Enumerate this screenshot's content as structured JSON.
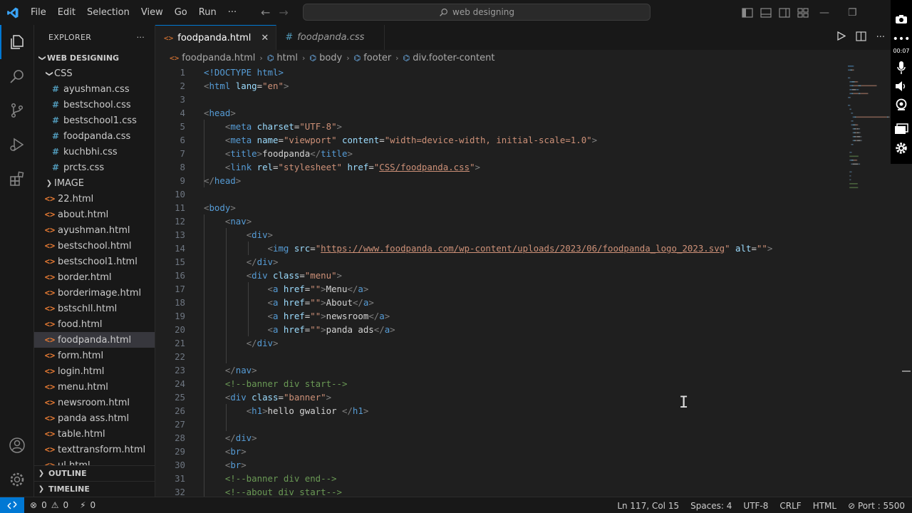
{
  "titlebar": {
    "menu": [
      "File",
      "Edit",
      "Selection",
      "View",
      "Go",
      "Run",
      "···"
    ],
    "search_text": "web designing"
  },
  "explorer": {
    "title": "EXPLORER",
    "more": "···",
    "root": "WEB DESIGNING",
    "css_folder": "CSS",
    "css_files": [
      "ayushman.css",
      "bestschool.css",
      "bestschool1.css",
      "foodpanda.css",
      "kuchbhi.css",
      "prcts.css"
    ],
    "image_folder": "IMAGE",
    "html_files": [
      "22.html",
      "about.html",
      "ayushman.html",
      "bestschool.html",
      "bestschool1.html",
      "border.html",
      "borderimage.html",
      "bstschll.html",
      "food.html",
      "foodpanda.html",
      "form.html",
      "login.html",
      "menu.html",
      "newsroom.html",
      "panda ass.html",
      "table.html",
      "texttransform.html",
      "ul.html"
    ],
    "selected_file": "foodpanda.html",
    "outline": "OUTLINE",
    "timeline": "TIMELINE"
  },
  "tabs": [
    {
      "label": "foodpanda.html",
      "icon": "<>",
      "active": true
    },
    {
      "label": "foodpanda.css",
      "icon": "#",
      "active": false
    }
  ],
  "breadcrumb": [
    "foodpanda.html",
    "html",
    "body",
    "footer",
    "div.footer-content"
  ],
  "code_lines": [
    [
      [
        "doc",
        "<!DOCTYPE "
      ],
      [
        "t-tag",
        "html"
      ],
      [
        "doc",
        ">"
      ]
    ],
    [
      [
        "br",
        "<"
      ],
      [
        "tag",
        "html "
      ],
      [
        "attr",
        "lang"
      ],
      [
        "txt",
        "="
      ],
      [
        "str",
        "\"en\""
      ],
      [
        "br",
        ">"
      ]
    ],
    [],
    [
      [
        "br",
        "<"
      ],
      [
        "tag",
        "head"
      ],
      [
        "br",
        ">"
      ]
    ],
    [
      [
        "sp",
        "    "
      ],
      [
        "br",
        "<"
      ],
      [
        "tag",
        "meta "
      ],
      [
        "attr",
        "charset"
      ],
      [
        "txt",
        "="
      ],
      [
        "str",
        "\"UTF-8\""
      ],
      [
        "br",
        ">"
      ]
    ],
    [
      [
        "sp",
        "    "
      ],
      [
        "br",
        "<"
      ],
      [
        "tag",
        "meta "
      ],
      [
        "attr",
        "name"
      ],
      [
        "txt",
        "="
      ],
      [
        "str",
        "\"viewport\" "
      ],
      [
        "attr",
        "content"
      ],
      [
        "txt",
        "="
      ],
      [
        "str",
        "\"width=device-width, initial-scale=1.0\""
      ],
      [
        "br",
        ">"
      ]
    ],
    [
      [
        "sp",
        "    "
      ],
      [
        "br",
        "<"
      ],
      [
        "tag",
        "title"
      ],
      [
        "br",
        ">"
      ],
      [
        "txt",
        "foodpanda"
      ],
      [
        "br",
        "</"
      ],
      [
        "tag",
        "title"
      ],
      [
        "br",
        ">"
      ]
    ],
    [
      [
        "sp",
        "    "
      ],
      [
        "br",
        "<"
      ],
      [
        "tag",
        "link "
      ],
      [
        "attr",
        "rel"
      ],
      [
        "txt",
        "="
      ],
      [
        "str",
        "\"stylesheet\" "
      ],
      [
        "attr",
        "href"
      ],
      [
        "txt",
        "="
      ],
      [
        "str",
        "\""
      ],
      [
        "link",
        "CSS/foodpanda.css"
      ],
      [
        "str",
        "\""
      ],
      [
        "br",
        ">"
      ]
    ],
    [
      [
        "br",
        "</"
      ],
      [
        "tag",
        "head"
      ],
      [
        "br",
        ">"
      ]
    ],
    [],
    [
      [
        "br",
        "<"
      ],
      [
        "tag",
        "body"
      ],
      [
        "br",
        ">"
      ]
    ],
    [
      [
        "sp",
        "    "
      ],
      [
        "br",
        "<"
      ],
      [
        "tag",
        "nav"
      ],
      [
        "br",
        ">"
      ]
    ],
    [
      [
        "sp",
        "        "
      ],
      [
        "br",
        "<"
      ],
      [
        "tag",
        "div"
      ],
      [
        "br",
        ">"
      ]
    ],
    [
      [
        "sp",
        "            "
      ],
      [
        "br",
        "<"
      ],
      [
        "tag",
        "img "
      ],
      [
        "attr",
        "src"
      ],
      [
        "txt",
        "="
      ],
      [
        "str",
        "\""
      ],
      [
        "link",
        "https://www.foodpanda.com/wp-content/uploads/2023/06/foodpanda_logo_2023.svg"
      ],
      [
        "str",
        "\" "
      ],
      [
        "attr",
        "alt"
      ],
      [
        "txt",
        "="
      ],
      [
        "str",
        "\"\""
      ],
      [
        "br",
        ">"
      ]
    ],
    [
      [
        "sp",
        "        "
      ],
      [
        "br",
        "</"
      ],
      [
        "tag",
        "div"
      ],
      [
        "br",
        ">"
      ]
    ],
    [
      [
        "sp",
        "        "
      ],
      [
        "br",
        "<"
      ],
      [
        "tag",
        "div "
      ],
      [
        "attr",
        "class"
      ],
      [
        "txt",
        "="
      ],
      [
        "str",
        "\"menu\""
      ],
      [
        "br",
        ">"
      ]
    ],
    [
      [
        "sp",
        "            "
      ],
      [
        "br",
        "<"
      ],
      [
        "tag",
        "a "
      ],
      [
        "attr",
        "href"
      ],
      [
        "txt",
        "="
      ],
      [
        "str",
        "\"\""
      ],
      [
        "br",
        ">"
      ],
      [
        "txt",
        "Menu"
      ],
      [
        "br",
        "</"
      ],
      [
        "tag",
        "a"
      ],
      [
        "br",
        ">"
      ]
    ],
    [
      [
        "sp",
        "            "
      ],
      [
        "br",
        "<"
      ],
      [
        "tag",
        "a "
      ],
      [
        "attr",
        "href"
      ],
      [
        "txt",
        "="
      ],
      [
        "str",
        "\"\""
      ],
      [
        "br",
        ">"
      ],
      [
        "txt",
        "About"
      ],
      [
        "br",
        "</"
      ],
      [
        "tag",
        "a"
      ],
      [
        "br",
        ">"
      ]
    ],
    [
      [
        "sp",
        "            "
      ],
      [
        "br",
        "<"
      ],
      [
        "tag",
        "a "
      ],
      [
        "attr",
        "href"
      ],
      [
        "txt",
        "="
      ],
      [
        "str",
        "\"\""
      ],
      [
        "br",
        ">"
      ],
      [
        "txt",
        "newsroom"
      ],
      [
        "br",
        "</"
      ],
      [
        "tag",
        "a"
      ],
      [
        "br",
        ">"
      ]
    ],
    [
      [
        "sp",
        "            "
      ],
      [
        "br",
        "<"
      ],
      [
        "tag",
        "a "
      ],
      [
        "attr",
        "href"
      ],
      [
        "txt",
        "="
      ],
      [
        "str",
        "\"\""
      ],
      [
        "br",
        ">"
      ],
      [
        "txt",
        "panda ads"
      ],
      [
        "br",
        "</"
      ],
      [
        "tag",
        "a"
      ],
      [
        "br",
        ">"
      ]
    ],
    [
      [
        "sp",
        "        "
      ],
      [
        "br",
        "</"
      ],
      [
        "tag",
        "div"
      ],
      [
        "br",
        ">"
      ]
    ],
    [],
    [
      [
        "sp",
        "    "
      ],
      [
        "br",
        "</"
      ],
      [
        "tag",
        "nav"
      ],
      [
        "br",
        ">"
      ]
    ],
    [
      [
        "sp",
        "    "
      ],
      [
        "cmt",
        "<!--banner div start-->"
      ]
    ],
    [
      [
        "sp",
        "    "
      ],
      [
        "br",
        "<"
      ],
      [
        "tag",
        "div "
      ],
      [
        "attr",
        "class"
      ],
      [
        "txt",
        "="
      ],
      [
        "str",
        "\"banner\""
      ],
      [
        "br",
        ">"
      ]
    ],
    [
      [
        "sp",
        "        "
      ],
      [
        "br",
        "<"
      ],
      [
        "tag",
        "h1"
      ],
      [
        "br",
        ">"
      ],
      [
        "txt",
        "hello gwalior "
      ],
      [
        "br",
        "</"
      ],
      [
        "tag",
        "h1"
      ],
      [
        "br",
        ">"
      ]
    ],
    [],
    [
      [
        "sp",
        "    "
      ],
      [
        "br",
        "</"
      ],
      [
        "tag",
        "div"
      ],
      [
        "br",
        ">"
      ]
    ],
    [
      [
        "sp",
        "    "
      ],
      [
        "br",
        "<"
      ],
      [
        "tag",
        "br"
      ],
      [
        "br",
        ">"
      ]
    ],
    [
      [
        "sp",
        "    "
      ],
      [
        "br",
        "<"
      ],
      [
        "tag",
        "br"
      ],
      [
        "br",
        ">"
      ]
    ],
    [
      [
        "sp",
        "    "
      ],
      [
        "cmt",
        "<!--banner div end-->"
      ]
    ],
    [
      [
        "sp",
        "    "
      ],
      [
        "cmt",
        "<!--about div start-->"
      ]
    ]
  ],
  "overlay": {
    "time": "00:07"
  },
  "status": {
    "errors": "0",
    "warnings": "0",
    "ports": "0",
    "position": "Ln 117, Col 15",
    "spaces": "Spaces: 4",
    "encoding": "UTF-8",
    "eol": "CRLF",
    "language": "HTML",
    "port": "Port : 5500"
  },
  "colors": {
    "accent": "#0078d4",
    "html_icon": "#e37933",
    "css_icon": "#519aba"
  }
}
